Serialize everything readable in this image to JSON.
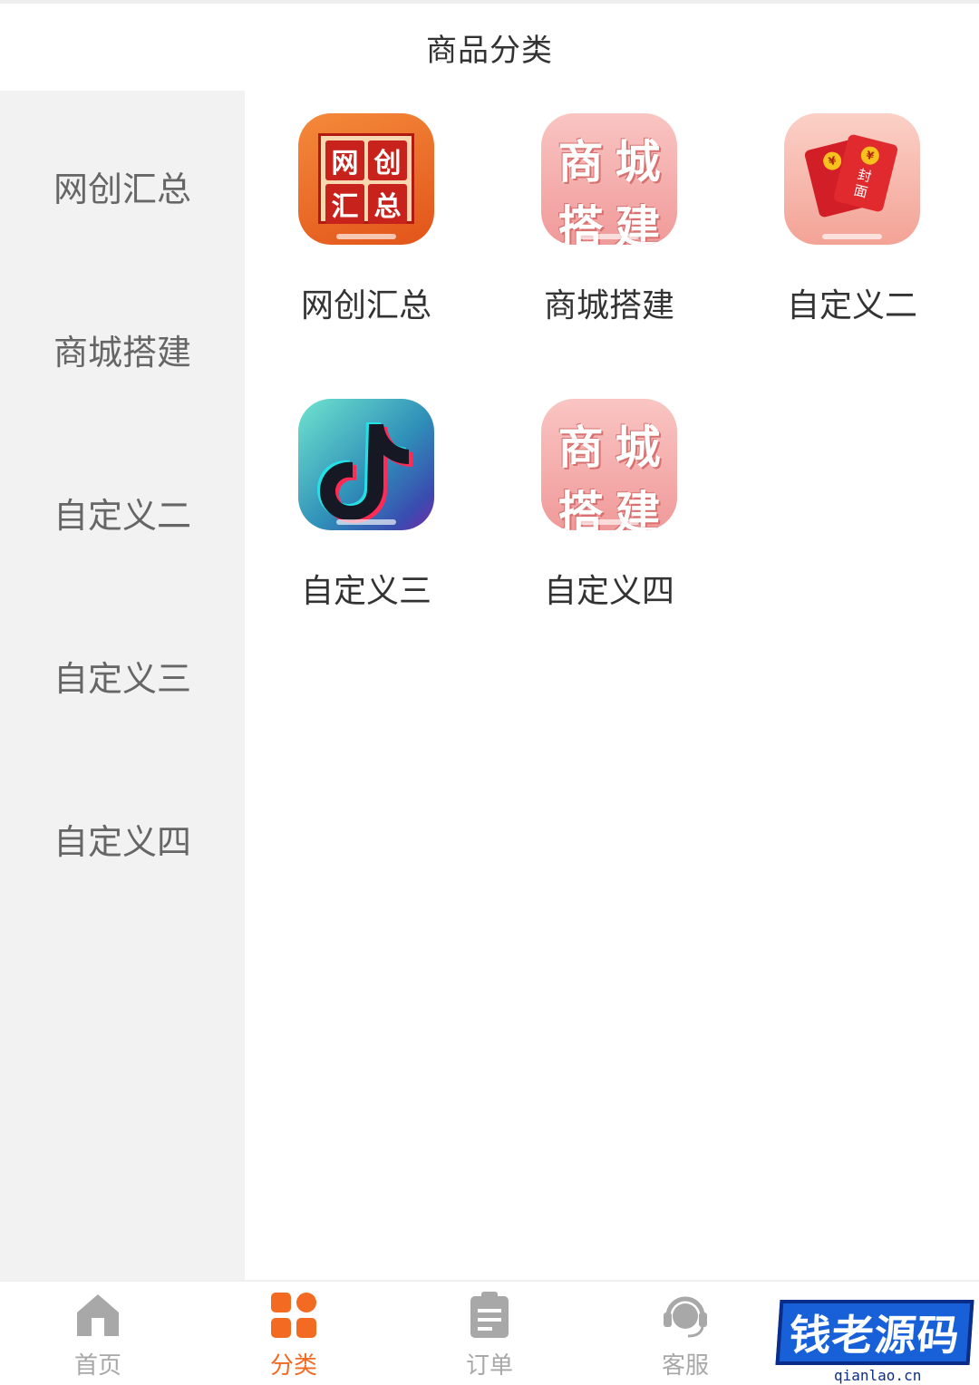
{
  "header": {
    "title": "商品分类"
  },
  "sidebar": {
    "items": [
      {
        "label": "网创汇总"
      },
      {
        "label": "商城搭建"
      },
      {
        "label": "自定义二"
      },
      {
        "label": "自定义三"
      },
      {
        "label": "自定义四"
      }
    ]
  },
  "grid": {
    "items": [
      {
        "label": "网创汇总",
        "icon": "wangchuang-huizong-icon",
        "icon_text": [
          "网",
          "创",
          "汇",
          "总"
        ]
      },
      {
        "label": "商城搭建",
        "icon": "shangcheng-dajian-icon",
        "icon_text": [
          "商",
          "城",
          "搭",
          "建"
        ]
      },
      {
        "label": "自定义二",
        "icon": "red-envelope-icon",
        "icon_text": [
          "封",
          "面"
        ],
        "coin_symbol": "¥"
      },
      {
        "label": "自定义三",
        "icon": "tiktok-icon"
      },
      {
        "label": "自定义四",
        "icon": "shangcheng-dajian-icon",
        "icon_text": [
          "商",
          "城",
          "搭",
          "建"
        ]
      }
    ]
  },
  "tabbar": {
    "items": [
      {
        "label": "首页",
        "icon": "home-icon"
      },
      {
        "label": "分类",
        "icon": "category-grid-icon",
        "active": true
      },
      {
        "label": "订单",
        "icon": "clipboard-icon"
      },
      {
        "label": "客服",
        "icon": "headset-icon"
      }
    ],
    "active_color": "#f36b22",
    "inactive_color": "#a8a8a8"
  },
  "watermark": {
    "text": "钱老源码",
    "url": "qianlao.cn"
  }
}
